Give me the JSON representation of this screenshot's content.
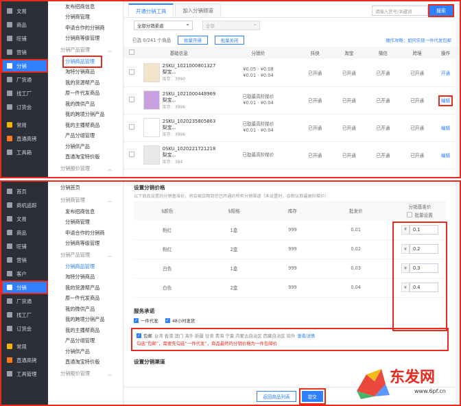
{
  "top": {
    "left_nav": [
      {
        "label": "文易",
        "icon": "chat-icon"
      },
      {
        "label": "商品",
        "icon": "goods-icon"
      },
      {
        "label": "旺铺",
        "icon": "store-icon"
      },
      {
        "label": "营销",
        "icon": "marketing-icon"
      },
      {
        "label": "分销",
        "icon": "distribution-icon",
        "active": true
      },
      {
        "label": "厂货通",
        "icon": "factory-icon"
      },
      {
        "label": "找工厂",
        "icon": "find-factory-icon"
      },
      {
        "label": "订货会",
        "icon": "order-fair-icon"
      },
      {
        "label": "常用",
        "icon": "star-icon"
      },
      {
        "label": "直通高铐",
        "icon": "hot-icon"
      },
      {
        "label": "工具箱",
        "icon": "toolbox-icon"
      }
    ],
    "sub_nav_top": [
      "友布招商信息",
      "分销商管理",
      "申请合作的分销商",
      "分销商等级管理"
    ],
    "sub_group_products": "分销产品管理",
    "sub_nav_products": [
      "分销商品管理",
      "淘特分销商品",
      "我的货源帮产品",
      "原一件代发商品",
      "我的微供产品",
      "我的跨境分销产品",
      "我的主播帮商品",
      "产品分组管理",
      "分销供产品",
      "直通淘宝特价版"
    ],
    "sub_group_level": "分销报价管理",
    "tabs": [
      "开通分销工具",
      "加入分销频道"
    ],
    "search_placeholder": "请输入货号/关键词",
    "search_button": "搜索",
    "filter_channel": "全部分销渠道",
    "filter_all": "全部",
    "selected_count": "已选 0/241 个商品",
    "batch_open": "批量开通",
    "batch_close": "批量关闭",
    "guide_link": "操作攻略：如何实现一件代发包邮",
    "columns": [
      "基础信息",
      "分销价",
      "抖快",
      "淘宝",
      "微信",
      "跨境",
      "操作"
    ],
    "rows": [
      {
        "sku": "2SKU_1021000801327梨宝...",
        "stock": "库存：3990",
        "price": "¥0.05 - ¥0.08\n¥0.01 - ¥0.04",
        "douyin": "已开通",
        "taobao": "已开通",
        "weixin": "已开通",
        "cross": "已开通",
        "op": "开通"
      },
      {
        "sku": "2SKU_1021000448969梨宝...",
        "stock": "库存：3996",
        "price": "已取最高阶梯价\n¥0.01 - ¥0.04",
        "douyin": "已开通",
        "taobao": "已开通",
        "weixin": "已开通",
        "cross": "已开通",
        "op": "编辑"
      },
      {
        "sku": "2SKU_1020235805863梨宝...",
        "stock": "库存：3996",
        "price": "已取最高阶梯价\n¥0.01 - ¥0.04",
        "douyin": "已开通",
        "taobao": "已开通",
        "weixin": "已开通",
        "cross": "已开通",
        "op": "编辑"
      },
      {
        "sku": "0SKU_1020221721218梨宝...",
        "stock": "库存：384",
        "price": "已取最高阶梯价",
        "douyin": "已开通",
        "taobao": "已开通",
        "weixin": "已开通",
        "cross": "已开通",
        "op": "编辑"
      }
    ]
  },
  "bottom": {
    "left_nav": [
      {
        "label": "首页",
        "icon": "home-icon"
      },
      {
        "label": "商机追踪",
        "icon": "opportunity-icon"
      },
      {
        "label": "文易",
        "icon": "chat-icon"
      },
      {
        "label": "商品",
        "icon": "goods-icon"
      },
      {
        "label": "旺铺",
        "icon": "store-icon"
      },
      {
        "label": "营销",
        "icon": "marketing-icon"
      },
      {
        "label": "客户",
        "icon": "customer-icon"
      },
      {
        "label": "分销",
        "icon": "distribution-icon",
        "active": true
      },
      {
        "label": "厂货通",
        "icon": "factory-icon"
      },
      {
        "label": "找工厂",
        "icon": "find-factory-icon"
      },
      {
        "label": "订货会",
        "icon": "order-fair-icon"
      },
      {
        "label": "常用",
        "icon": "star-icon"
      },
      {
        "label": "直通高铐",
        "icon": "hot-icon"
      },
      {
        "label": "工具管理",
        "icon": "toolbox-icon"
      }
    ],
    "sub_home": "分销首页",
    "sub_group_dist": "分销商管理",
    "sub_nav_dist": [
      "发布招商信息",
      "分销商管理",
      "申请合作的分销商",
      "分销商等级管理"
    ],
    "sub_group_products": "分销产品管理",
    "sub_nav_products": [
      "分销商品管理",
      "淘特分销商品",
      "我的货源帮产品",
      "原一件代发商品",
      "我的微供产品",
      "我的跨境分销产品",
      "我的主播帮商品",
      "产品分组管理",
      "分销供产品",
      "直通淘宝特价版"
    ],
    "sub_group_level": "分销报价管理",
    "price_title": "设置分销价格",
    "price_note": "以下商品设置的分销基准价，将会被应用到您已开通的所有分销渠道（未设置时，会默认取最高阶梯价）",
    "price_cols": [
      "$颜色",
      "$规格",
      "库存",
      "批发价",
      "分销基准价"
    ],
    "batch_label": "批量设置",
    "currency": "¥",
    "price_rows": [
      {
        "color": "粉红",
        "spec": "1盒",
        "stock": "999",
        "wholesale": "0.01",
        "base": "0.1"
      },
      {
        "color": "粉红",
        "spec": "2盒",
        "stock": "999",
        "wholesale": "0.02",
        "base": "0.2"
      },
      {
        "color": "白色",
        "spec": "1盒",
        "stock": "999",
        "wholesale": "0.03",
        "base": "0.3"
      },
      {
        "color": "白色",
        "spec": "2盒",
        "stock": "999",
        "wholesale": "0.04",
        "base": "0.4"
      }
    ],
    "service_title": "服务承诺",
    "svc_dropship": "一件代发",
    "svc_48h": "48小时发货",
    "svc_free": "包邮",
    "svc_regions": "台湾 香港 澳门 海外 新疆 甘肃 青海 宁夏 内蒙古自治区 西藏自治区 除外",
    "svc_detail": "查看详情",
    "svc_warning": "勾选“包邮”，需要先勾选“一件代发”，商品最终的分销价格为一件包邮价",
    "channel_title": "设置分销渠道",
    "back_button": "返回商品列表",
    "submit_button": "提交",
    "watermark": "东发网",
    "watermark_url": "www.6pf.cn"
  }
}
